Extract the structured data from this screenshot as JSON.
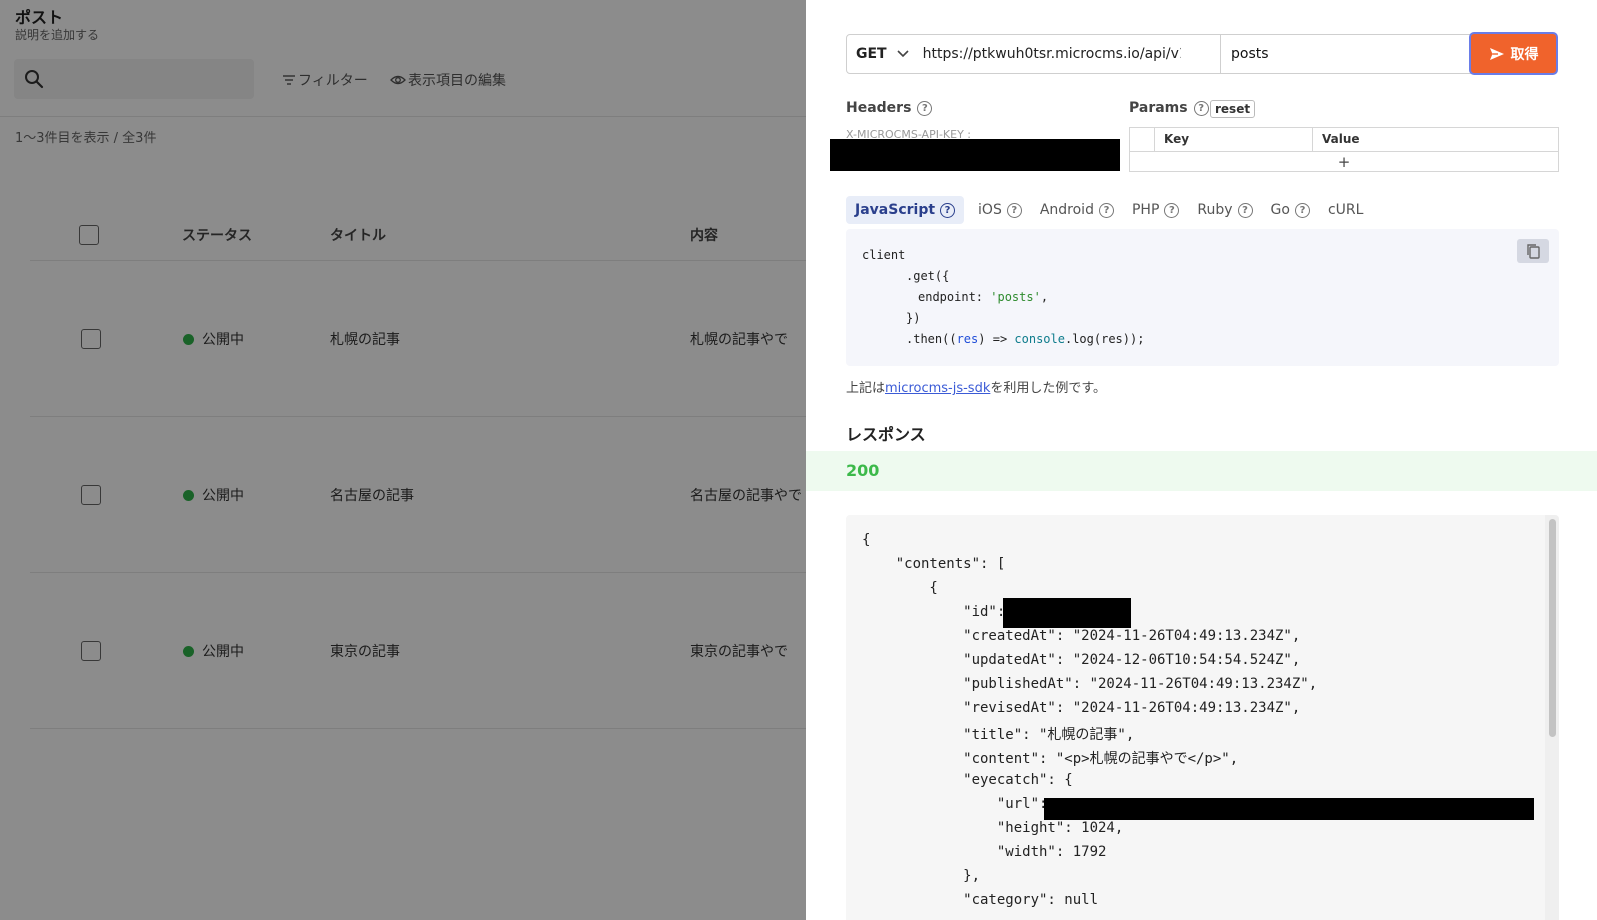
{
  "list_page": {
    "title": "ポスト",
    "description": "説明を追加する",
    "filter_label": "フィルター",
    "edit_columns_label": "表示項目の編集",
    "count_text": "1〜3件目を表示 / 全3件",
    "columns": [
      "ステータス",
      "タイトル",
      "内容"
    ],
    "rows": [
      {
        "status": "公開中",
        "title": "札幌の記事",
        "content": "札幌の記事やで"
      },
      {
        "status": "公開中",
        "title": "名古屋の記事",
        "content": "名古屋の記事やで"
      },
      {
        "status": "公開中",
        "title": "東京の記事",
        "content": "東京の記事やで"
      }
    ],
    "status_color": "#2fb34a"
  },
  "api_preview": {
    "method": "GET",
    "base_url": "https://ptkwuh0tsr.microcms.io/api/v1/",
    "endpoint": "posts",
    "send_label": "取得",
    "send_color": "#f0632c",
    "headers_label": "Headers",
    "params_label": "Params",
    "reset_label": "reset",
    "header_key": "X-MICROCMS-API-KEY :",
    "params_columns": [
      "Key",
      "Value"
    ],
    "add_param_label": "+",
    "tabs": [
      {
        "label": "JavaScript",
        "active": true
      },
      {
        "label": "iOS",
        "active": false
      },
      {
        "label": "Android",
        "active": false
      },
      {
        "label": "PHP",
        "active": false
      },
      {
        "label": "Ruby",
        "active": false
      },
      {
        "label": "Go",
        "active": false
      },
      {
        "label": "cURL",
        "active": false
      }
    ],
    "code": {
      "l1": "client",
      "l2": ".get({",
      "l3_key": "endpoint: ",
      "l3_val": "'posts'",
      "l3_end": ",",
      "l4": "})",
      "l5a": ".then((",
      "l5b": "res",
      "l5c": ") => ",
      "l5d": "console",
      "l5e": ".log(res));"
    },
    "sdk_note_prefix": "上記は",
    "sdk_link": "microcms-js-sdk",
    "sdk_note_suffix": "を利用した例です。",
    "response_title": "レスポンス",
    "status_code": "200",
    "response_lines": [
      "{",
      "    \"contents\": [",
      "        {",
      "            \"id\": ",
      "            \"createdAt\": \"2024-11-26T04:49:13.234Z\",",
      "            \"updatedAt\": \"2024-12-06T10:54:54.524Z\",",
      "            \"publishedAt\": \"2024-11-26T04:49:13.234Z\",",
      "            \"revisedAt\": \"2024-11-26T04:49:13.234Z\",",
      "            \"title\": \"札幌の記事\",",
      "            \"content\": \"<p>札幌の記事やで</p>\",",
      "            \"eyecatch\": {",
      "                \"url\": ",
      "                \"height\": 1024,",
      "                \"width\": 1792",
      "            },",
      "            \"category\": null"
    ]
  }
}
